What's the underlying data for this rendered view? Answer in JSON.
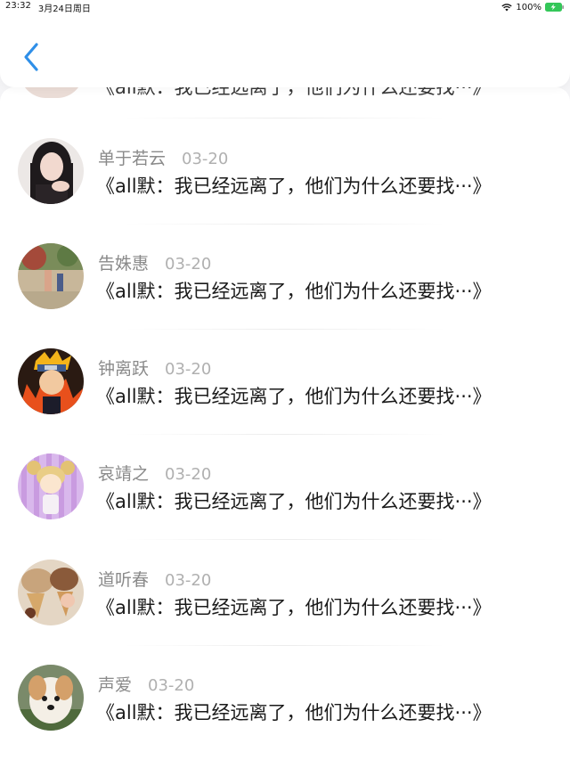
{
  "status_bar": {
    "time": "23:32",
    "date": "3月24日周日",
    "battery": "100%"
  },
  "nav": {
    "back_icon": "chevron-left-icon"
  },
  "partial_item": {
    "text": "《all默：我已经远离了，他们为什么还要找···》"
  },
  "items": [
    {
      "name": "单于若云",
      "date": "03-20",
      "message": "《all默：我已经远离了，他们为什么还要找···》"
    },
    {
      "name": "告姝惠",
      "date": "03-20",
      "message": "《all默：我已经远离了，他们为什么还要找···》"
    },
    {
      "name": "钟离跃",
      "date": "03-20",
      "message": "《all默：我已经远离了，他们为什么还要找···》"
    },
    {
      "name": "哀靖之",
      "date": "03-20",
      "message": "《all默：我已经远离了，他们为什么还要找···》"
    },
    {
      "name": "道听春",
      "date": "03-20",
      "message": "《all默：我已经远离了，他们为什么还要找···》"
    },
    {
      "name": "声爱",
      "date": "03-20",
      "message": "《all默：我已经远离了，他们为什么还要找···》"
    }
  ],
  "colors": {
    "accent": "#2f8fe8",
    "name_gray": "#8a8a8a",
    "date_gray": "#b0b0b0",
    "battery_green": "#34c759"
  }
}
